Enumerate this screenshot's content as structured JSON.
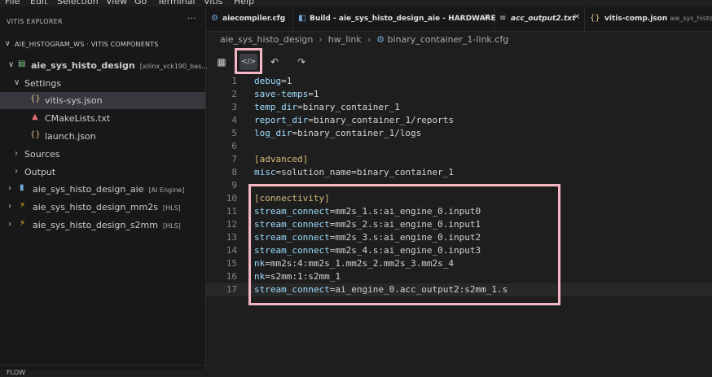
{
  "menubar": [
    "File",
    "Edit",
    "Selection",
    "View",
    "Go",
    "Terminal",
    "Vitis",
    "Help"
  ],
  "sidebar": {
    "title": "VITIS EXPLORER",
    "more": "···",
    "workspace": "AIE_HISTOGRAM_WS · VITIS COMPONENTS",
    "project": {
      "name": "aie_sys_histo_design",
      "tag": "[xilinx_vck190_bas..."
    },
    "settings_label": "Settings",
    "settings_files": [
      "vitis-sys.json",
      "CMakeLists.txt",
      "launch.json"
    ],
    "sources_label": "Sources",
    "output_label": "Output",
    "components": [
      {
        "name": "aie_sys_histo_design_aie",
        "tag": "[AI Engine]"
      },
      {
        "name": "aie_sys_histo_design_mm2s",
        "tag": "[HLS]"
      },
      {
        "name": "aie_sys_histo_design_s2mm",
        "tag": "[HLS]"
      }
    ],
    "flow_label": "FLOW"
  },
  "tabs": [
    {
      "label": "aiecompiler.cfg",
      "icon": "gear-icon"
    },
    {
      "label": "Build - aie_sys_histo_design_aie - HARDWARE",
      "icon": "build-icon"
    },
    {
      "label": "acc_output2.txt",
      "icon": "text-file-icon"
    },
    {
      "label": "vitis-comp.json",
      "icon": "json-icon",
      "extra": "aie_sys_histo_..."
    }
  ],
  "breadcrumb": [
    "aie_sys_histo_design",
    "hw_link",
    "binary_container_1-link.cfg"
  ],
  "code_lines": [
    {
      "n": "1",
      "key": "debug",
      "val": "1"
    },
    {
      "n": "2",
      "key": "save-temps",
      "val": "1"
    },
    {
      "n": "3",
      "key": "temp_dir",
      "val": "binary_container_1"
    },
    {
      "n": "4",
      "key": "report_dir",
      "val": "binary_container_1/reports"
    },
    {
      "n": "5",
      "key": "log_dir",
      "val": "binary_container_1/logs"
    },
    {
      "n": "6",
      "key": "",
      "val": ""
    },
    {
      "n": "7",
      "section": "[advanced]"
    },
    {
      "n": "8",
      "key": "misc",
      "val": "solution_name=binary_container_1"
    },
    {
      "n": "9",
      "key": "",
      "val": ""
    },
    {
      "n": "10",
      "section": "[connectivity]"
    },
    {
      "n": "11",
      "key": "stream_connect",
      "val": "mm2s_1.s:ai_engine_0.input0"
    },
    {
      "n": "12",
      "key": "stream_connect",
      "val": "mm2s_2.s:ai_engine_0.input1"
    },
    {
      "n": "13",
      "key": "stream_connect",
      "val": "mm2s_3.s:ai_engine_0.input2"
    },
    {
      "n": "14",
      "key": "stream_connect",
      "val": "mm2s_4.s:ai_engine_0.input3"
    },
    {
      "n": "15",
      "key": "nk",
      "val": "mm2s:4:mm2s_1.mm2s_2.mm2s_3.mm2s_4"
    },
    {
      "n": "16",
      "key": "nk",
      "val": "s2mm:1:s2mm_1"
    },
    {
      "n": "17",
      "key": "stream_connect",
      "val": "ai_engine_0.acc_output2:s2mm_1.s"
    }
  ],
  "colors": {
    "highlight": "#f4b6c2",
    "accent": "#4a8fd6"
  }
}
